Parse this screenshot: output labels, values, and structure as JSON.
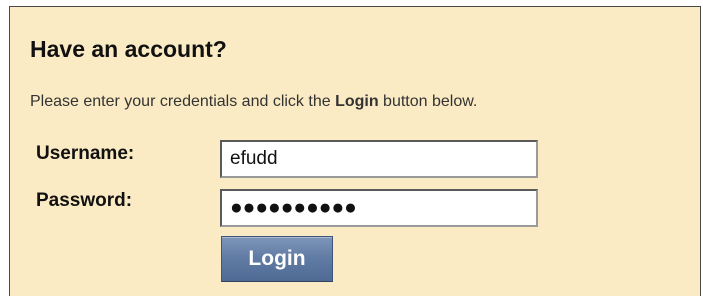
{
  "login_panel": {
    "title": "Have an account?",
    "instructions": {
      "before": "Please enter your credentials and click the ",
      "bold": "Login",
      "after": " button below."
    },
    "username": {
      "label": "Username:",
      "value": "efudd"
    },
    "password": {
      "label": "Password:",
      "value": "●●●●●●●●●●"
    },
    "login_button_label": "Login"
  },
  "colors": {
    "panel_background": "#fbebc4",
    "button_background": "#5f7aa3",
    "button_text": "#ffffff"
  }
}
